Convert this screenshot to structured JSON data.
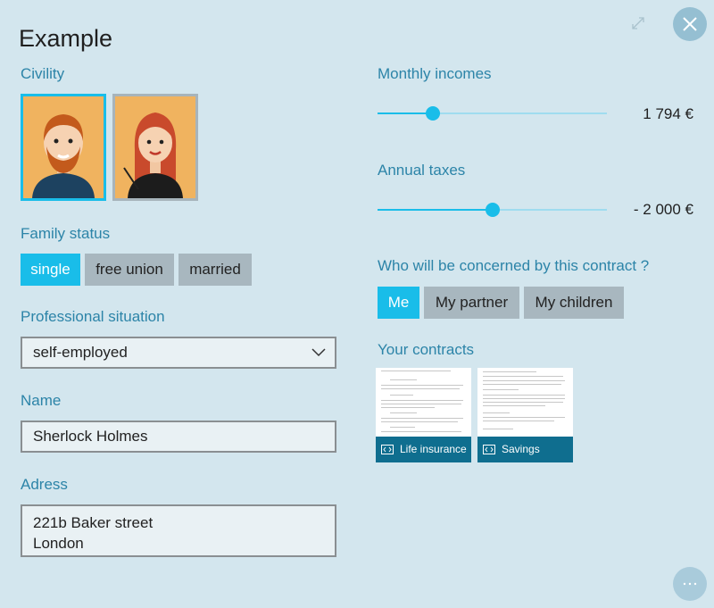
{
  "title": "Example",
  "labels": {
    "civility": "Civility",
    "family_status": "Family status",
    "professional_situation": "Professional situation",
    "name": "Name",
    "address": "Adress",
    "monthly_incomes": "Monthly incomes",
    "annual_taxes": "Annual taxes",
    "concerned": "Who will be concerned by this contract ?",
    "contracts": "Your contracts"
  },
  "civility": {
    "selected": "male"
  },
  "family_status": {
    "options": [
      "single",
      "free union",
      "married"
    ],
    "selected": "single"
  },
  "professional_situation": {
    "value": "self-employed"
  },
  "name": {
    "value": "Sherlock Holmes"
  },
  "address": {
    "line1": "221b Baker street",
    "line2": "London"
  },
  "monthly_incomes": {
    "value_text": "1 794 €",
    "level": 0.24
  },
  "annual_taxes": {
    "value_text": "- 2 000 €",
    "level": 0.5
  },
  "concerned": {
    "options": [
      "Me",
      "My partner",
      "My children"
    ],
    "selected": "Me"
  },
  "contracts": [
    {
      "label": "Life insurance"
    },
    {
      "label": "Savings"
    }
  ],
  "colors": {
    "background": "#d3e6ee",
    "accent": "#19bde9",
    "label": "#2c84a8",
    "contract_bar": "#0f6e8f",
    "segment_off": "#a8b7bf"
  },
  "icons": [
    "close-icon",
    "expand-icon",
    "more-icon",
    "chevron-down-icon",
    "code-icon"
  ]
}
